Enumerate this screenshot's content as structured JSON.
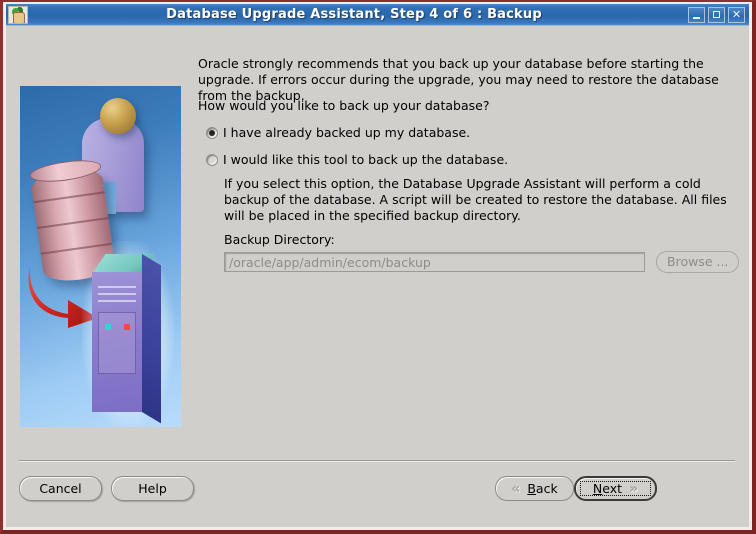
{
  "window": {
    "title": "Database Upgrade Assistant, Step 4 of 6 : Backup",
    "icon": "oracle-assistant-icon",
    "controls": {
      "minimize": "minimize-icon",
      "maximize": "maximize-icon",
      "close": "✕"
    }
  },
  "illustration": {
    "name": "database-upgrade-illustration",
    "alt": "Person with database cylinder, red arrow, and server tower"
  },
  "main": {
    "intro": "Oracle strongly recommends that you back up your database before starting the upgrade. If errors occur during the upgrade, you may need to restore the database from the backup.",
    "question": "How would you like to back up your database?",
    "options": [
      {
        "label": "I have already backed up my database.",
        "selected": true
      },
      {
        "label": "I would like this tool to back up the database.",
        "selected": false
      }
    ],
    "option_description": "If you select this option, the Database Upgrade Assistant will perform a cold backup of the database. A script will be created to restore the database. All files will be placed in the specified backup directory.",
    "backup_directory": {
      "label": "Backup Directory:",
      "value": "/oracle/app/admin/ecom/backup",
      "placeholder": "",
      "disabled": true
    },
    "browse_button": "Browse ..."
  },
  "footer": {
    "cancel_label": "Cancel",
    "help_label": "Help",
    "back": {
      "label": "Back",
      "mnemonic": "B",
      "prefix": "",
      "suffix": "ack",
      "chevron": "«"
    },
    "next": {
      "label": "Next",
      "mnemonic": "N",
      "prefix": "",
      "suffix": "ext",
      "chevron": "»"
    }
  },
  "colors": {
    "titlebar": "#2f6fb4",
    "frame_border": "#7d2323",
    "dialog_bg": "#d0cfcb",
    "disabled_text": "#8d8c88"
  }
}
